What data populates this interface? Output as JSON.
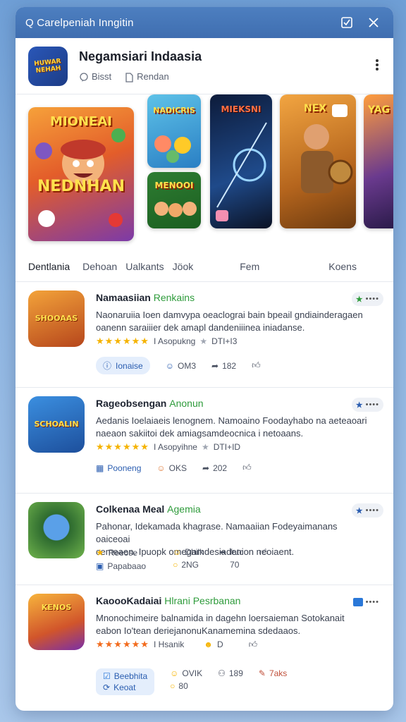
{
  "window": {
    "title": "Q Carelpeniah Inngitin"
  },
  "app": {
    "name": "Negamsiari Indaasia",
    "meta": [
      "Bisst",
      "Rendan"
    ],
    "logo_text": "HUWAR NEHAH"
  },
  "featured": [
    {
      "title": "MIONEAI",
      "subtitle": "NEDNHAN"
    },
    {
      "title": "NADICRIS"
    },
    {
      "title": "MENOOI"
    },
    {
      "title": "MIEKSNI"
    },
    {
      "title": "NEX"
    },
    {
      "title": "YAG"
    }
  ],
  "tabs": [
    "Dentlania",
    "Dehoan",
    "Ualkants",
    "Jöok",
    "Fem",
    "Koens"
  ],
  "items": [
    {
      "title": "Namaasiian",
      "title_highlight": "Renkains",
      "desc_line1": "Naonaruiia  Ioen damvypa oeaclograi bain bpeail gndiainderagaen",
      "desc_line2": "oanenn saraiiier dek amapl dandeniiinea iniadanse.",
      "rating_label": "I Asopukng",
      "rating_value": "DTI+I3",
      "action_pill": "Ionaise",
      "action_2": "OM3",
      "action_3": "182",
      "icon_text": "SHOOAAS"
    },
    {
      "title": "Rageobsengan",
      "title_highlight": "Anonun",
      "desc_line1": "Aedanis Ioelaiaeis lenognem. Namoaino Foodayhabo na aeteaoari",
      "desc_line2": "naeaon sakiitoi dek amiagsamdeocnica i netoaans.",
      "rating_label": "I Asopyihne",
      "rating_value": "DTI+ID",
      "action_pill": "Pooneng",
      "action_2": "OKS",
      "action_3": "202",
      "icon_text": "SCHOALIN"
    },
    {
      "title": "Colkenaa Meal",
      "title_highlight": "Agemia",
      "desc_line1": "Pahonar, Idekamada khagrase. Namaaiian Fodeyaimanans oaiceoai",
      "desc_line2": "cemeaen. Ipuopk omegamdesiadenion neoiaent.",
      "rating_label": "Reeose",
      "rating_sub": "Papabaao",
      "action_2": "Dhilk",
      "action_2b": "2NG",
      "action_3": "fatc",
      "action_3b": "70",
      "icon_text": ""
    },
    {
      "title": "KaoooKadaiai",
      "title_highlight": "Hlrani Pesrbanan",
      "desc_line1": "Mnonochimeire  balnamida  in  dagehn  loersaieman  Sotokanait",
      "desc_line2": "eabon Io'tean deriejanonuKanamemina sdedaaos.",
      "rating_label": "I Hsanik",
      "rating_value": "D",
      "action_pill": "Beebhita",
      "action_pill_b": "Keoat",
      "action_2": "OVIK",
      "action_2b": "80",
      "action_3": "189",
      "action_4": "7aks",
      "icon_text": "KENOS"
    }
  ],
  "colors": {
    "titlebar": "#4375b8",
    "accent_green": "#2e9b3b",
    "star": "#f5b301",
    "pill_bg": "#e4eefc"
  }
}
